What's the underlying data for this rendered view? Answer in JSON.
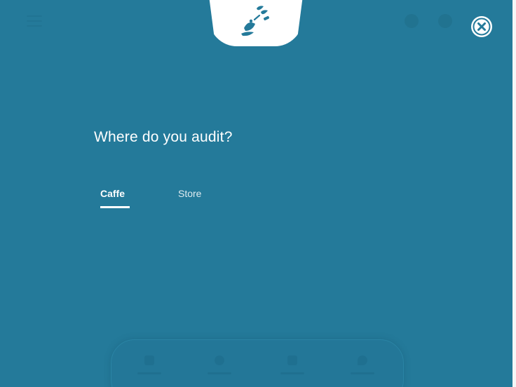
{
  "header": {
    "logo_icon": "coffee-logo-icon",
    "close_icon": "close-icon"
  },
  "main": {
    "question": "Where do you audit?",
    "tabs": [
      {
        "label": "Caffe",
        "selected": true
      },
      {
        "label": "Store",
        "selected": false
      }
    ]
  },
  "bottom_nav": {
    "icons": [
      "home-icon",
      "audit-icon",
      "report-icon",
      "location-icon"
    ]
  },
  "colors": {
    "background": "#247a9a",
    "accent": "#ffffff"
  }
}
